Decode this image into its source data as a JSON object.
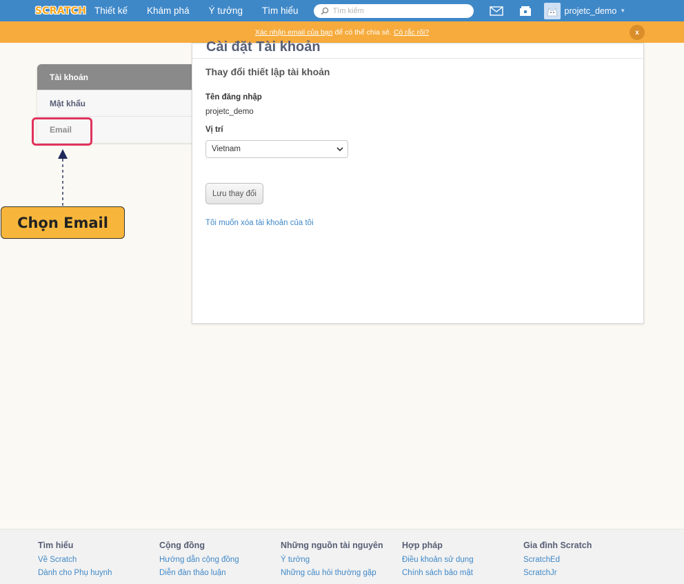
{
  "nav": {
    "logo": "SCRATCH",
    "links": [
      "Thiết kế",
      "Khám phá",
      "Ý tưởng",
      "Tìm hiểu"
    ],
    "search_placeholder": "Tìm kiếm",
    "username": "projetc_demo"
  },
  "banner": {
    "link1": "Xác nhận email của bạn",
    "middle": "để có thể chia sẻ.",
    "link2": "Có rắc rối?",
    "close": "x"
  },
  "sidebar": {
    "items": [
      "Tài khoản",
      "Mật khẩu",
      "Email"
    ]
  },
  "annotation": {
    "callout": "Chọn Email"
  },
  "main": {
    "title": "Cài đặt Tài khoản",
    "section_title": "Thay đổi thiết lập tài khoản",
    "username_label": "Tên đăng nhập",
    "username_value": "projetc_demo",
    "location_label": "Vị trí",
    "location_value": "Vietnam",
    "save_button": "Lưu thay đổi",
    "delete_link": "Tôi muốn xóa tài khoản của tôi"
  },
  "footer": {
    "columns": [
      {
        "heading": "Tìm hiểu",
        "links": [
          "Về Scratch",
          "Dành cho Phụ huynh"
        ]
      },
      {
        "heading": "Cộng đồng",
        "links": [
          "Hướng dẫn cộng đồng",
          "Diễn đàn thảo luận"
        ]
      },
      {
        "heading": "Những nguồn tài nguyên",
        "links": [
          "Ý tưởng",
          "Những câu hỏi thường gặp"
        ]
      },
      {
        "heading": "Hợp pháp",
        "links": [
          "Điều khoản sử dụng",
          "Chính sách bảo mật"
        ]
      },
      {
        "heading": "Gia đình Scratch",
        "links": [
          "ScratchEd",
          "ScratchJr"
        ]
      }
    ]
  },
  "colors": {
    "nav_blue": "#3f88c8",
    "banner_orange": "#f6ab3c",
    "highlight_pink": "#e0335c",
    "callout_yellow": "#f7b63b"
  },
  "icons": [
    "search-icon",
    "messages-icon",
    "my-stuff-icon",
    "avatar-icon",
    "chevron-down-icon",
    "close-icon",
    "arrow-up-icon"
  ]
}
